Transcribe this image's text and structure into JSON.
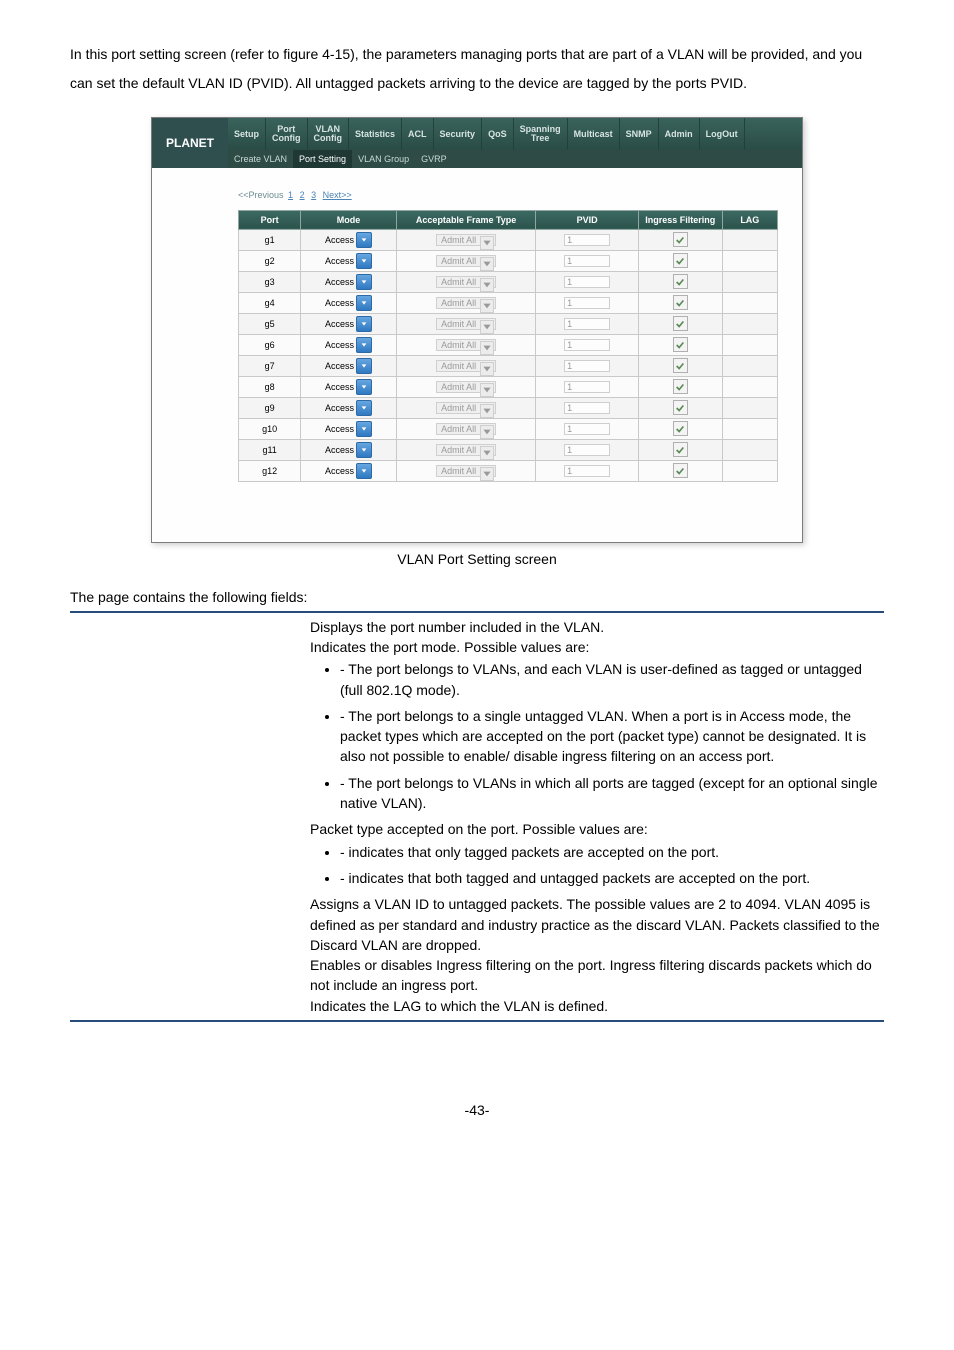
{
  "intro": "In this port setting screen (refer to figure 4-15), the parameters managing ports that are part of a VLAN will be provided, and you can set the default VLAN ID (PVID). All untagged packets arriving to the device are tagged by the ports PVID.",
  "screenshot": {
    "logo_text": "PLANET",
    "nav": [
      "Setup",
      "Port Config",
      "VLAN Config",
      "Statistics",
      "ACL",
      "Security",
      "QoS",
      "Spanning Tree",
      "Multicast",
      "SNMP",
      "Admin",
      "LogOut"
    ],
    "subnav": [
      "Create VLAN",
      "Port Setting",
      "VLAN Group",
      "GVRP"
    ],
    "subnav_active_index": 1,
    "pager": {
      "prev": "<<Previous",
      "pages": [
        "1",
        "2",
        "3"
      ],
      "next": "Next>>"
    },
    "columns": [
      "Port",
      "Mode",
      "Acceptable Frame Type",
      "PVID",
      "Ingress Filtering",
      "LAG"
    ],
    "mode_value": "Access",
    "frame_value": "Admit All",
    "pvid_value": "1",
    "ports": [
      "g1",
      "g2",
      "g3",
      "g4",
      "g5",
      "g6",
      "g7",
      "g8",
      "g9",
      "g10",
      "g11",
      "g12"
    ]
  },
  "caption": "VLAN Port Setting screen",
  "fields_intro": "The page contains the following fields:",
  "fields": {
    "port_desc": "Displays the port number included in the VLAN.",
    "mode_intro": "Indicates the port mode. Possible values are:",
    "mode_general": " - The port belongs to VLANs, and each VLAN is user-defined as tagged or untagged (full 802.1Q mode).",
    "mode_access": " - The port belongs to a single untagged VLAN. When a port is in Access mode, the packet types which are accepted on the port (packet type) cannot be designated. It is also not possible to enable/ disable ingress filtering on an access port.",
    "mode_trunk": " - The port belongs to VLANs in which all ports are tagged (except for an optional single native VLAN).",
    "frame_intro": "Packet type accepted on the port. Possible values are:",
    "frame_tag": " - indicates that only tagged packets are accepted on the port.",
    "frame_all": " - indicates that both tagged and untagged packets are accepted on the port.",
    "pvid": "Assigns a VLAN ID to untagged packets. The possible values are 2 to 4094. VLAN 4095 is defined as per standard and industry practice as the discard VLAN. Packets classified to the Discard VLAN are dropped.",
    "ingress": "Enables or disables Ingress filtering on the port. Ingress filtering discards packets which do not include an ingress port.",
    "lag": "Indicates the LAG to which the VLAN is defined."
  },
  "pagenum": "-43-"
}
